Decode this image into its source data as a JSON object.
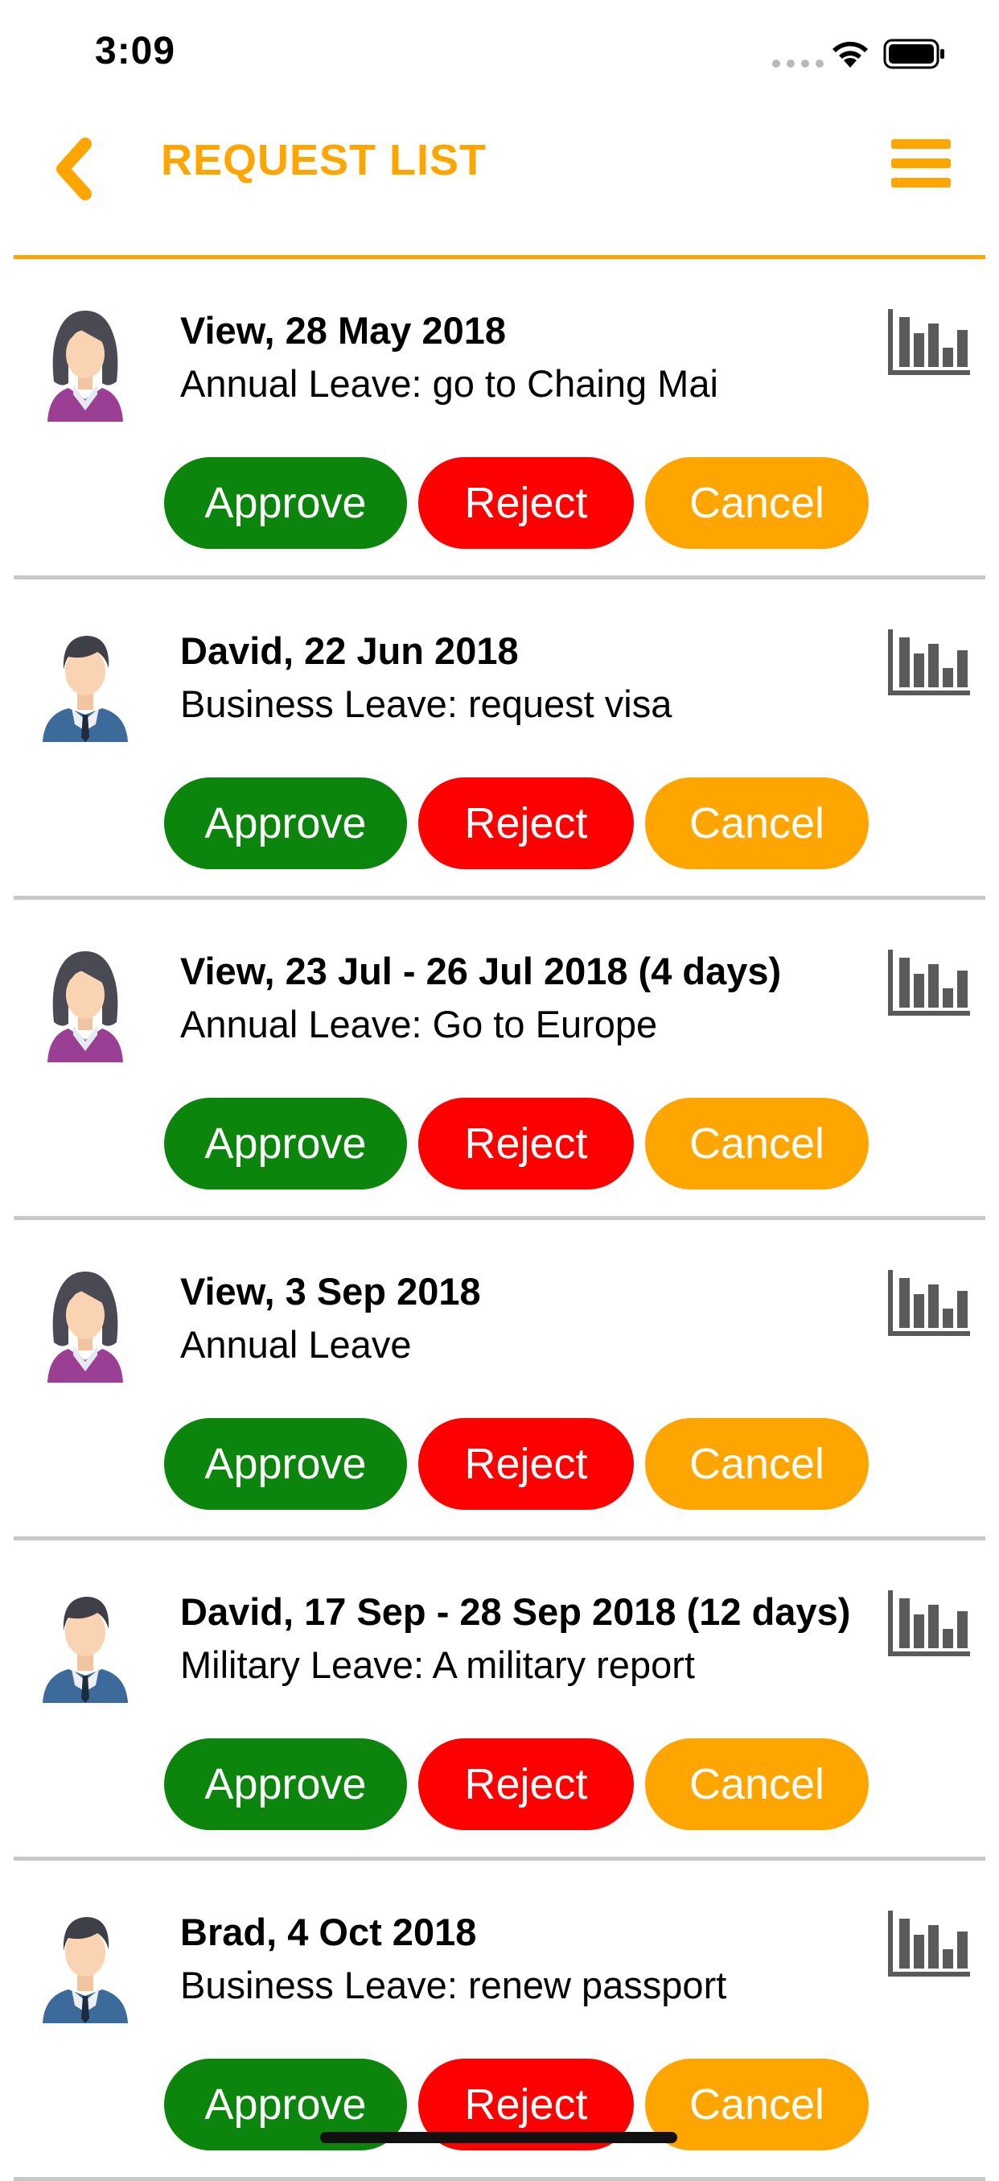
{
  "status_bar": {
    "time": "3:09"
  },
  "header": {
    "title": "REQUEST LIST",
    "back_icon": "chevron-left-icon",
    "menu_icon": "hamburger-menu-icon"
  },
  "colors": {
    "accent": "#FFA500",
    "approve": "#0B850B",
    "reject": "#FE0000",
    "cancel": "#FFA500",
    "separator": "#C8C8C8"
  },
  "actions": {
    "approve_label": "Approve",
    "reject_label": "Reject",
    "cancel_label": "Cancel"
  },
  "requests": [
    {
      "avatar": "female-avatar-icon",
      "title": "View, 28 May 2018",
      "detail": "Annual Leave: go to Chaing Mai",
      "stats_icon": "bar-chart-icon"
    },
    {
      "avatar": "male-avatar-icon",
      "title": "David, 22 Jun 2018",
      "detail": "Business Leave: request visa",
      "stats_icon": "bar-chart-icon"
    },
    {
      "avatar": "female-avatar-icon",
      "title": "View, 23 Jul - 26 Jul 2018 (4 days)",
      "detail": "Annual Leave: Go to Europe",
      "stats_icon": "bar-chart-icon"
    },
    {
      "avatar": "female-avatar-icon",
      "title": "View, 3 Sep 2018",
      "detail": "Annual Leave",
      "stats_icon": "bar-chart-icon"
    },
    {
      "avatar": "male-avatar-icon",
      "title": "David, 17 Sep - 28 Sep 2018 (12 days)",
      "detail": "Military Leave: A military report",
      "stats_icon": "bar-chart-icon"
    },
    {
      "avatar": "male-avatar-icon",
      "title": "Brad, 4 Oct 2018",
      "detail": "Business Leave: renew passport",
      "stats_icon": "bar-chart-icon"
    }
  ]
}
